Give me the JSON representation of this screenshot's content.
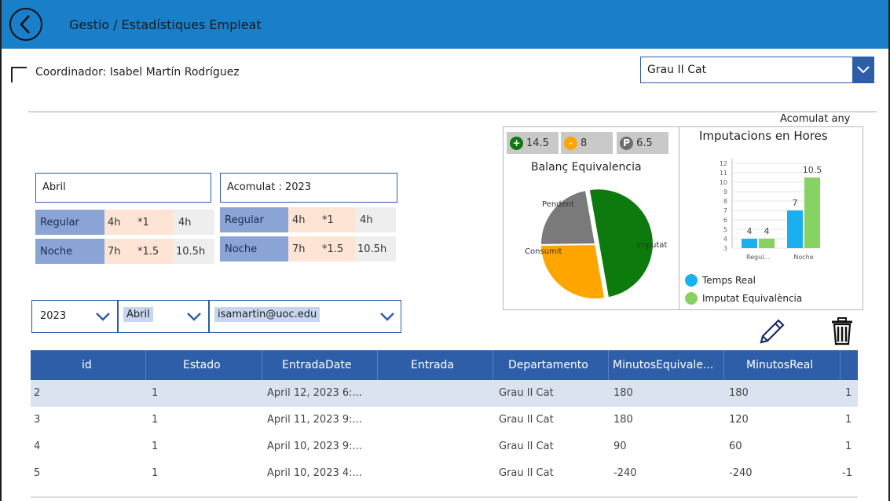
{
  "header": {
    "title": "Gestio / Estadístiques Empleat"
  },
  "coordinator": {
    "label": "Coordinador: Isabel Martín Rodríguez"
  },
  "category_select": {
    "value": "Grau II Cat"
  },
  "acomulat_any": "Acomulat any",
  "month_panel": {
    "title": "Abril",
    "rows": [
      {
        "label": "Regular",
        "hours": "4h",
        "factor": "*1",
        "result": "4h"
      },
      {
        "label": "Noche",
        "hours": "7h",
        "factor": "*1.5",
        "result": "10.5h"
      }
    ]
  },
  "year_panel": {
    "title": "Acomulat : 2023",
    "rows": [
      {
        "label": "Regular",
        "hours": "4h",
        "factor": "*1",
        "result": "4h"
      },
      {
        "label": "Noche",
        "hours": "7h",
        "factor": "*1.5",
        "result": "10.5h"
      }
    ]
  },
  "filters": {
    "year": "2023",
    "month": "Abril",
    "email": "isamartin@uoc.edu"
  },
  "badges": {
    "plus": {
      "icon": "+",
      "value": "14.5"
    },
    "minus": {
      "icon": "-",
      "value": "8"
    },
    "p": {
      "icon": "P",
      "value": "6.5"
    }
  },
  "colors": {
    "header": "#1a7fc9",
    "accent": "#2f5ea8",
    "imputat": "#0d7a0d",
    "consumit": "#ffa500",
    "pendent": "#7a7a7a",
    "temps_real": "#1ab0f0",
    "imputat_equivalencia": "#88d264"
  },
  "chart_data": [
    {
      "type": "pie",
      "title": "Balanç Equivalencia",
      "slices": [
        {
          "label": "Imputat",
          "value": 14.5,
          "color": "#0d7a0d"
        },
        {
          "label": "Consumit",
          "value": 8,
          "color": "#ffa500"
        },
        {
          "label": "Pendent",
          "value": 6.5,
          "color": "#7a7a7a"
        }
      ]
    },
    {
      "type": "bar",
      "title": "Imputacions en Hores",
      "categories": [
        "Regul...",
        "Noche"
      ],
      "ylim": [
        3,
        12
      ],
      "yticks": [
        3,
        4,
        5,
        6,
        7,
        8,
        9,
        10,
        11,
        12
      ],
      "series": [
        {
          "name": "Temps Real",
          "values": [
            4,
            7
          ],
          "color": "#1ab0f0"
        },
        {
          "name": "Imputat Equivalència",
          "values": [
            4,
            10.5
          ],
          "color": "#88d264"
        }
      ]
    }
  ],
  "table": {
    "columns": [
      "id",
      "Estado",
      "EntradaDate",
      "Entrada",
      "Departamento",
      "MinutosEquivale...",
      "MinutosReal"
    ],
    "rows": [
      {
        "id": "2",
        "estado": "1",
        "entrada_date": "April 12, 2023 6:...",
        "entrada": "",
        "departamento": "Grau II Cat",
        "min_equiv": "180",
        "min_real": "180",
        "extra": "1"
      },
      {
        "id": "3",
        "estado": "1",
        "entrada_date": "April 11, 2023 9:...",
        "entrada": "",
        "departamento": "Grau II Cat",
        "min_equiv": "180",
        "min_real": "120",
        "extra": "1"
      },
      {
        "id": "4",
        "estado": "1",
        "entrada_date": "April 10, 2023 9:...",
        "entrada": "",
        "departamento": "Grau II Cat",
        "min_equiv": "90",
        "min_real": "60",
        "extra": "1"
      },
      {
        "id": "5",
        "estado": "1",
        "entrada_date": "April 10, 2023 4:...",
        "entrada": "",
        "departamento": "Grau II Cat",
        "min_equiv": "-240",
        "min_real": "-240",
        "extra": "-1"
      }
    ]
  }
}
